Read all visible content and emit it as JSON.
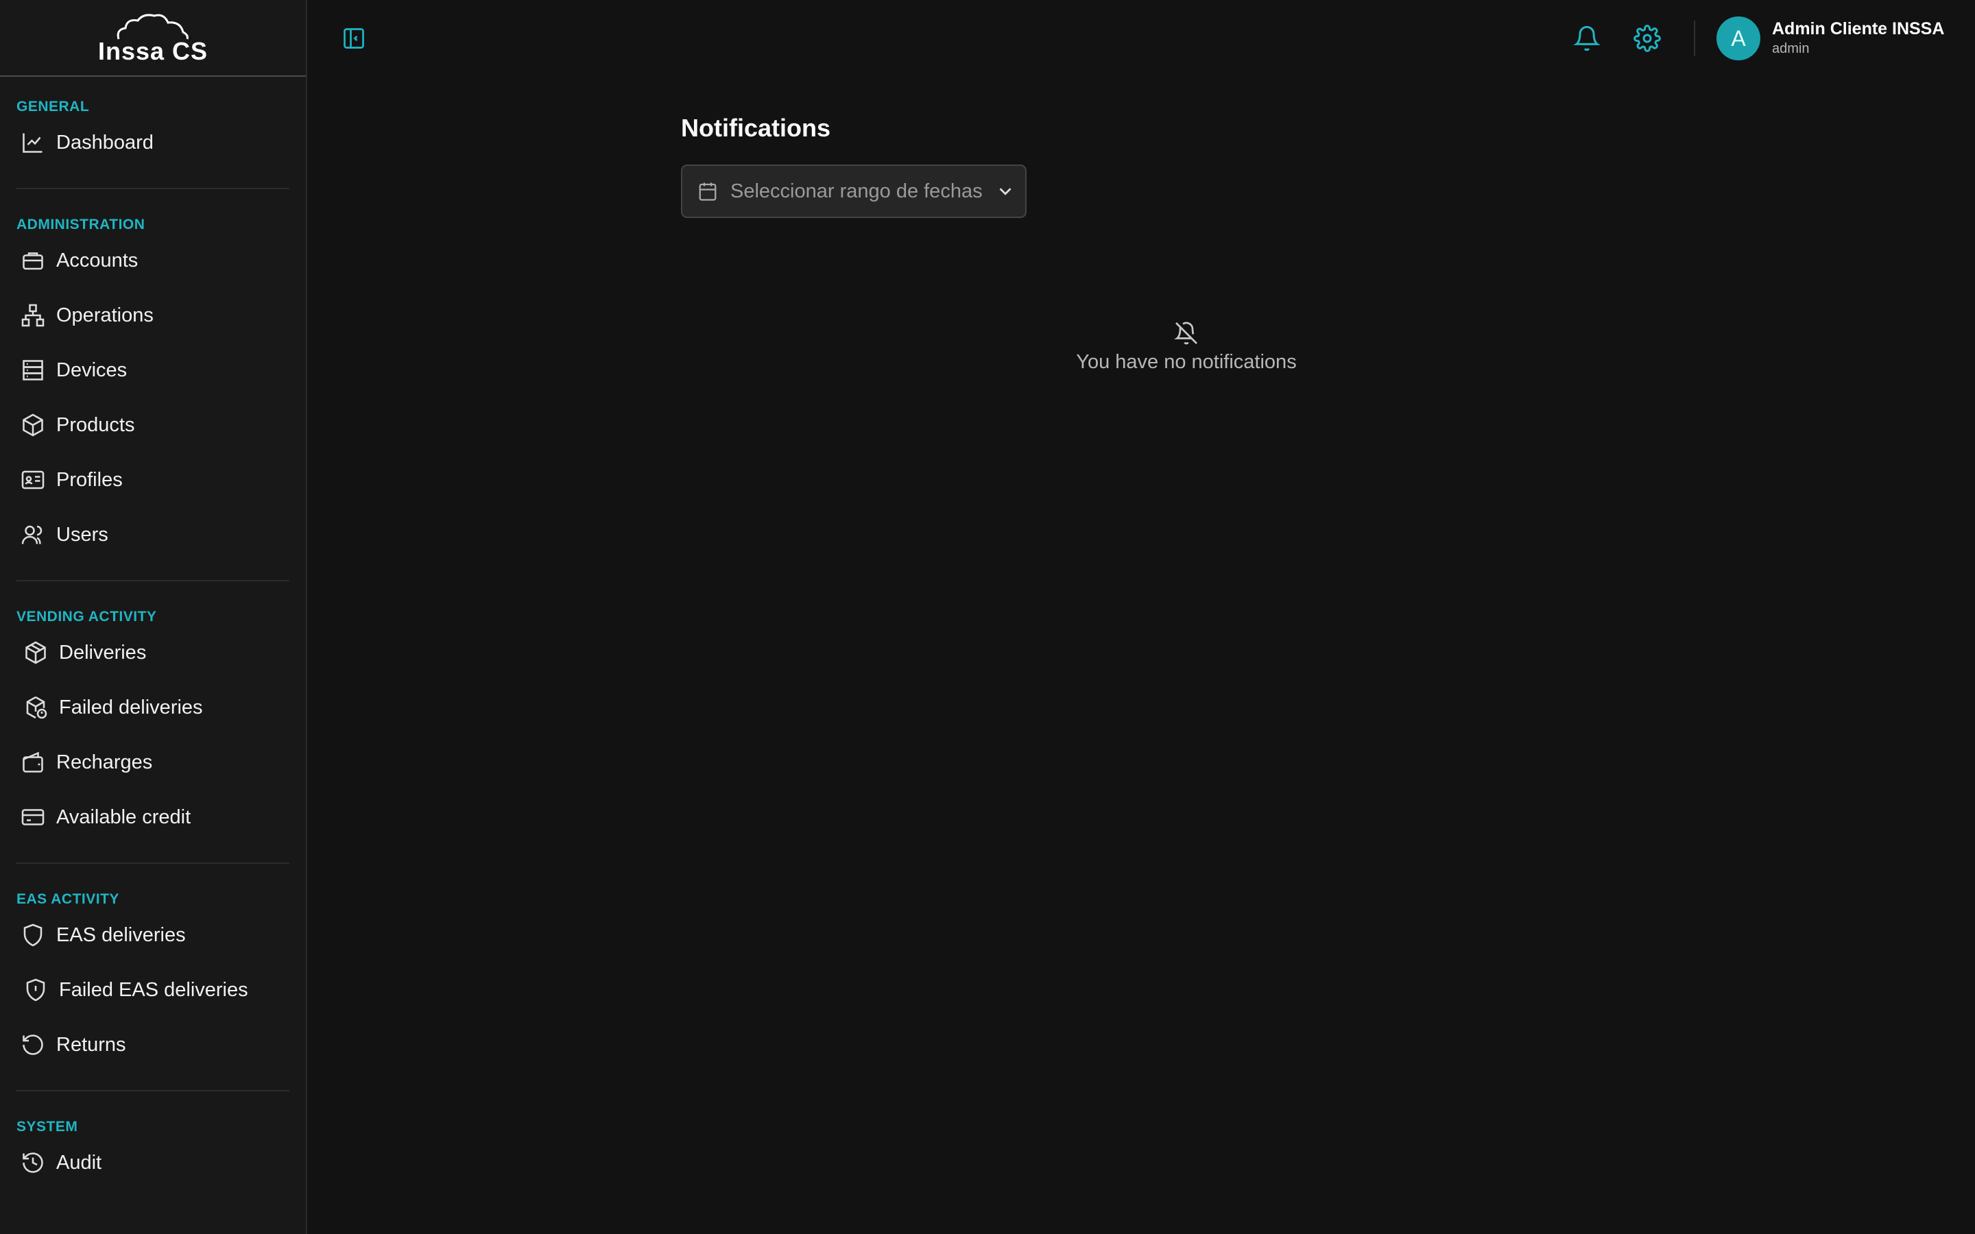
{
  "brand": {
    "logo_text": "Inssa CS"
  },
  "sidebar": {
    "sections": [
      {
        "title": "GENERAL",
        "items": [
          {
            "label": "Dashboard",
            "icon": "chart-line-icon"
          }
        ]
      },
      {
        "title": "ADMINISTRATION",
        "items": [
          {
            "label": "Accounts",
            "icon": "briefcase-icon"
          },
          {
            "label": "Operations",
            "icon": "network-icon"
          },
          {
            "label": "Devices",
            "icon": "server-icon"
          },
          {
            "label": "Products",
            "icon": "box-icon"
          },
          {
            "label": "Profiles",
            "icon": "id-card-icon"
          },
          {
            "label": "Users",
            "icon": "users-icon"
          }
        ]
      },
      {
        "title": "VENDING ACTIVITY",
        "items": [
          {
            "label": "Deliveries",
            "icon": "package-icon"
          },
          {
            "label": "Failed deliveries",
            "icon": "package-alert-icon"
          },
          {
            "label": "Recharges",
            "icon": "wallet-icon"
          },
          {
            "label": "Available credit",
            "icon": "credit-card-icon"
          }
        ]
      },
      {
        "title": "EAS ACTIVITY",
        "items": [
          {
            "label": "EAS deliveries",
            "icon": "shield-icon"
          },
          {
            "label": "Failed EAS deliveries",
            "icon": "shield-alert-icon"
          },
          {
            "label": "Returns",
            "icon": "undo-icon"
          }
        ]
      },
      {
        "title": "SYSTEM",
        "items": [
          {
            "label": "Audit",
            "icon": "history-icon"
          }
        ]
      }
    ]
  },
  "header": {
    "user_initial": "A",
    "user_name": "Admin Cliente INSSA",
    "user_role": "admin",
    "accent_color": "#1fb6c4"
  },
  "main": {
    "title": "Notifications",
    "date_range_placeholder": "Seleccionar rango de fechas",
    "empty_message": "You have no notifications"
  }
}
